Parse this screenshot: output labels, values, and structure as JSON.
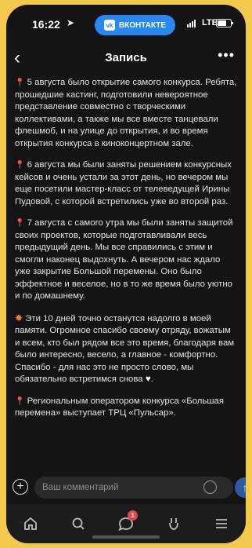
{
  "status": {
    "time": "16:22",
    "lte": "LTE",
    "vk_app": "ВКОНТАКТЕ"
  },
  "navbar": {
    "title": "Запись"
  },
  "post": {
    "p1": "5 августа было открытие самого конкурса. Ребята, прошедшие кастинг, подготовили невероятное представление совместно с творческими коллективами, а также мы все вместе танцевали флешмоб, и на улице до открытия, и во время открытия конкурса в киноконцертном зале.",
    "p2": "6 августа мы были заняты решением конкурсных кейсов и очень устали за этот день, но вечером мы еще посетили мастер-класс от телеведущей Ирины Пудовой, с которой встретились уже во второй раз.",
    "p3": "7 августа с самого утра мы были заняты защитой своих проектов, которые подготавливали весь предыдущий день. Мы все справились с этим и смогли наконец выдохнуть. А вечером нас ждало уже закрытие Большой перемены. Оно было эффектное и веселое, но в то же время было уютно и по домашнему.",
    "p4a": "Эти 10 дней точно останутся надолго в моей памяти. Огромное спасибо своему отряду, вожатым и всем, кто был рядом все это время, благодаря вам было интересно, весело, а главное - комфортно.",
    "p4b": "Спасибо - для нас это не просто слово, мы обязательно встретимся снова",
    "p5": "Региональным оператором конкурса «Большая перемена» выступает ТРЦ «Пульсар»."
  },
  "comment": {
    "placeholder": "Ваш комментарий"
  },
  "tabs": {
    "messages_badge": "1"
  }
}
